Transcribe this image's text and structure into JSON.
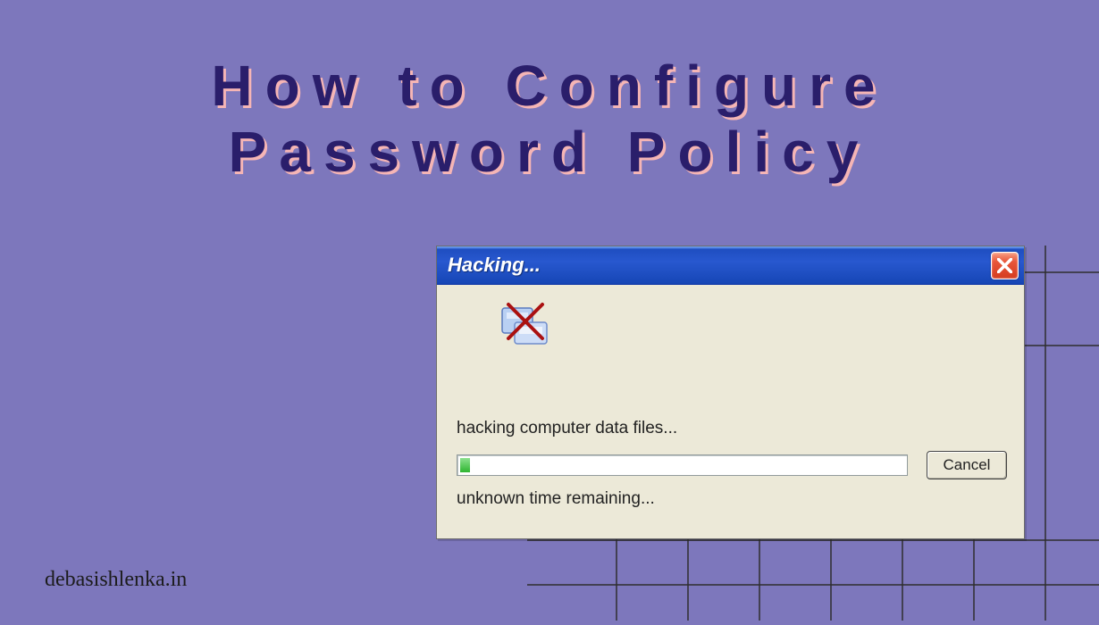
{
  "header": {
    "title_line1": "How to Configure",
    "title_line2": "Password Policy"
  },
  "watermark": "debasishlenka.in",
  "dialog": {
    "title": "Hacking...",
    "close_label": "Close",
    "status_text": "hacking computer data files...",
    "time_text": "unknown time remaining...",
    "cancel_label": "Cancel",
    "progress_percent": 2
  }
}
